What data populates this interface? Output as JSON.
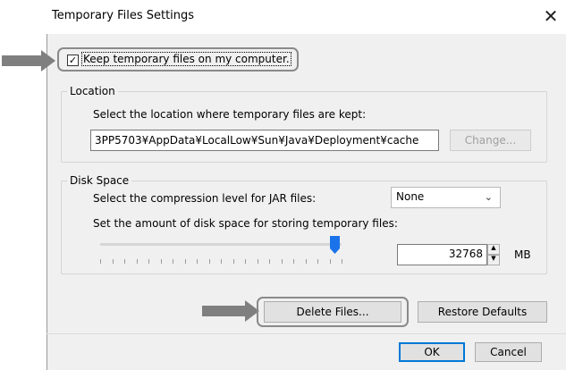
{
  "window": {
    "title": "Temporary Files Settings",
    "close_glyph": "✕"
  },
  "keep": {
    "label": "Keep temporary files on my computer.",
    "checked_glyph": "✓",
    "checked": true
  },
  "location": {
    "group_label": "Location",
    "description": "Select the location where temporary files are kept:",
    "path": "3PP5703¥AppData¥LocalLow¥Sun¥Java¥Deployment¥cache",
    "change_label": "Change..."
  },
  "disk": {
    "group_label": "Disk Space",
    "compression_label": "Select the compression level for JAR files:",
    "compression_value": "None",
    "space_label": "Set the amount of disk space for storing temporary files:",
    "space_value": "32768",
    "unit": "MB",
    "slider_fraction": 1.0
  },
  "actions": {
    "delete_label": "Delete Files...",
    "restore_label": "Restore Defaults",
    "ok_label": "OK",
    "cancel_label": "Cancel"
  },
  "colors": {
    "annotation_arrow": "#7f7f7f",
    "slider_thumb": "#1a73e8",
    "ok_border": "#0078d7"
  }
}
